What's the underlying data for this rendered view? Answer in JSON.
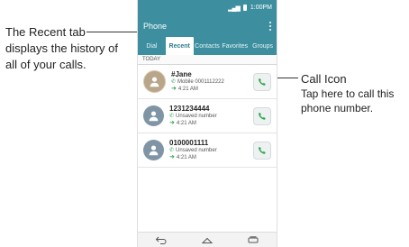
{
  "callouts": {
    "left": [
      "The Recent tab",
      "displays the history of",
      "all of your calls."
    ],
    "right_title": "Call Icon",
    "right_desc": [
      "Tap here to call this",
      "phone number."
    ]
  },
  "status_bar": {
    "time": "1:00PM"
  },
  "app": {
    "title": "Phone"
  },
  "tabs": [
    {
      "label": "Dial",
      "active": false
    },
    {
      "label": "Recent",
      "active": true
    },
    {
      "label": "Contacts",
      "active": false
    },
    {
      "label": "Favorites",
      "active": false
    },
    {
      "label": "Groups",
      "active": false
    }
  ],
  "section": {
    "label": "TODAY"
  },
  "calls": [
    {
      "name": "#Jane",
      "detail": "Mobile 0001112222",
      "time": "4:21 AM",
      "avatar": "photo"
    },
    {
      "name": "1231234444",
      "detail": "Unsaved number",
      "time": "4:21 AM",
      "avatar": "generic"
    },
    {
      "name": "0100001111",
      "detail": "Unsaved number",
      "time": "4:21 AM",
      "avatar": "generic"
    }
  ],
  "colors": {
    "accent": "#3d8fa0",
    "call_green": "#2fa84f"
  },
  "icons": {
    "back": "back-icon",
    "home": "home-icon",
    "recents": "recent-apps-icon"
  }
}
